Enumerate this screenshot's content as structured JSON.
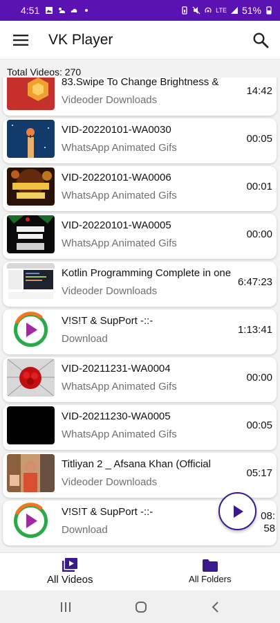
{
  "status_bar": {
    "time": "4:51",
    "battery": "51%",
    "network": "LTE"
  },
  "app_bar": {
    "title": "VK Player",
    "menu_icon": "hamburger-menu-icon",
    "search_icon": "search-icon"
  },
  "total_videos_label": "Total Videos: 270",
  "videos": [
    {
      "title": "83.Swipe To Change Brightness &",
      "folder": "Videoder Downloads",
      "duration": "14:42",
      "thumb": "orange-hexagon"
    },
    {
      "title": "VID-20220101-WA0030",
      "folder": "WhatsApp Animated Gifs",
      "duration": "00:05",
      "thumb": "candle-night"
    },
    {
      "title": "VID-20220101-WA0006",
      "folder": "WhatsApp Animated Gifs",
      "duration": "00:01",
      "thumb": "new-year-fireworks"
    },
    {
      "title": "VID-20220101-WA0005",
      "folder": "WhatsApp Animated Gifs",
      "duration": "00:00",
      "thumb": "happy-new-year-2022"
    },
    {
      "title": "Kotlin Programming Complete in one",
      "folder": "Videoder Downloads",
      "duration": "6:47:23",
      "thumb": "code-screenshot"
    },
    {
      "title": "V!S!T & SupPort -::-",
      "folder": "Download",
      "duration": "1:13:41",
      "thumb": "play-logo"
    },
    {
      "title": "VID-20211231-WA0004",
      "folder": "WhatsApp Animated Gifs",
      "duration": "00:00",
      "thumb": "red-roses"
    },
    {
      "title": "VID-20211230-WA0005",
      "folder": "WhatsApp Animated Gifs",
      "duration": "00:05",
      "thumb": "black"
    },
    {
      "title": "Titliyan 2 _ Afsana Khan (Official",
      "folder": "Videoder Downloads",
      "duration": "05:17",
      "thumb": "music-video"
    },
    {
      "title": "V!S!T & SupPort -::-",
      "folder": "Download",
      "duration": "08:58",
      "thumb": "play-logo"
    }
  ],
  "fab_icon": "play-icon",
  "bottom_nav": [
    {
      "label": "All Videos",
      "icon": "video-library-icon",
      "active": true
    },
    {
      "label": "All Folders",
      "icon": "folder-icon",
      "active": false
    }
  ],
  "colors": {
    "status_bar": "#5a12b3",
    "accent": "#3a1a8a",
    "secondary_text": "#707070"
  }
}
